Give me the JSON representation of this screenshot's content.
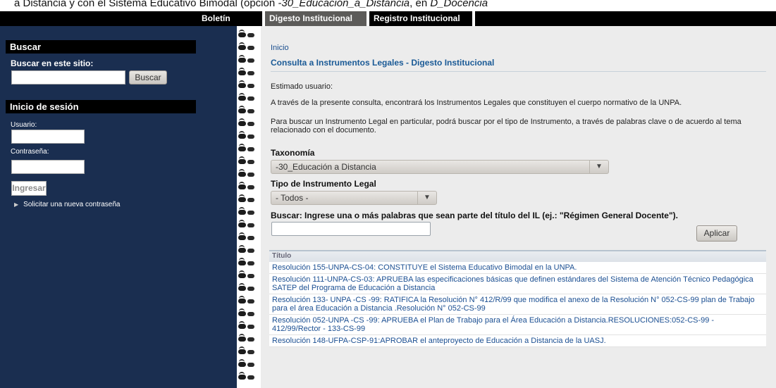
{
  "caption": {
    "prefix": "a Distancia y con el Sistema Educativo Bimodal (opción ",
    "italic1": "-30_Educación_a_Distancia",
    "middle": ", en ",
    "italic2": "D_Docencia"
  },
  "menu": {
    "tabs": [
      {
        "label": "Boletín Oficial"
      },
      {
        "label": "Digesto Institucional"
      },
      {
        "label": "Registro Institucional"
      }
    ]
  },
  "sidebar": {
    "search": {
      "title": "Buscar",
      "label": "Buscar en este sitio:",
      "value": "",
      "button": "Buscar"
    },
    "login": {
      "title": "Inicio de sesión",
      "user_label": "Usuario:",
      "user_value": "",
      "password_label": "Contraseña:",
      "password_value": "",
      "submit": "Ingresar",
      "forgot_link": "Solicitar una nueva contraseña"
    }
  },
  "main": {
    "breadcrumb": "Inicio",
    "title": "Consulta a Instrumentos Legales - Digesto Institucional",
    "greeting": "Estimado usuario:",
    "intro": "A través de la presente consulta, encontrará los Instrumentos Legales que constituyen el cuerpo normativo de la UNPA.",
    "help": "Para buscar un Instrumento Legal en particular, podrá buscar por el tipo de Instrumento, a través de palabras clave o de acuerdo al tema relacionado con el documento.",
    "taxonomy_label": "Taxonomía",
    "taxonomy_value": "-30_Educación a Distancia",
    "type_label": "Tipo de Instrumento Legal",
    "type_value": "- Todos -",
    "search_label": "Buscar: Ingrese una o más palabras que sean parte del título del IL (ej.: \"Régimen General Docente\").",
    "search_value": "",
    "apply_button": "Aplicar",
    "table": {
      "header": "Título",
      "rows": [
        "Resolución 155-UNPA-CS-04: CONSTITUYE el Sistema Educativo Bimodal en la UNPA.",
        "Resolución 111-UNPA-CS-03: APRUEBA las especificaciones básicas que definen estándares del Sistema de Atención Técnico Pedagógica SATEP del Programa de Educación a Distancia",
        "Resolución 133- UNPA -CS -99: RATIFICA la Resolución N° 412/R/99 que modifica el anexo de la Resolución N° 052-CS-99 plan de Trabajo para el área Educación a Distancia .Resolución N° 052-CS-99",
        "Resolución 052-UNPA -CS -99: APRUEBA el Plan de Trabajo para el Área Educación a Distancia.RESOLUCIONES:052-CS-99 - 412/99/Rector - 133-CS-99",
        "Resolución 148-UFPA-CSP-91:APROBAR el anteproyecto de Educación a Distancia de la UASJ."
      ]
    }
  },
  "icons": {
    "dropdown": "triangle-down",
    "link_bullet": "triangle-right"
  },
  "colors": {
    "sidebar": "#1a2e50",
    "menubar": "#000000",
    "link": "#1b4f92",
    "active_tab": "#5c5b59"
  }
}
